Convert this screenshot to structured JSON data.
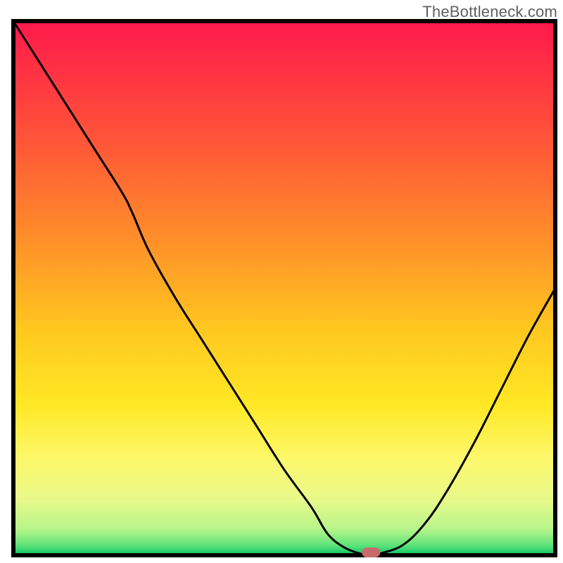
{
  "attribution": "TheBottleneck.com",
  "chart_data": {
    "type": "line",
    "title": "",
    "xlabel": "",
    "ylabel": "",
    "xlim": [
      0,
      100
    ],
    "ylim": [
      0,
      100
    ],
    "x": [
      0,
      5,
      10,
      15,
      20,
      22,
      25,
      30,
      35,
      40,
      45,
      50,
      55,
      58,
      61,
      64,
      66,
      68,
      72,
      76,
      80,
      85,
      90,
      95,
      100
    ],
    "values": [
      100,
      92,
      84,
      76,
      68,
      64,
      57,
      48,
      40,
      32,
      24,
      16,
      9,
      4,
      1.5,
      0.3,
      0,
      0.4,
      2,
      6,
      12,
      21,
      31,
      41,
      50
    ],
    "minimum_marker": {
      "x": 66,
      "y": 0
    },
    "gradient_stops": [
      {
        "offset": 0.0,
        "color": "#ff1a4b"
      },
      {
        "offset": 0.2,
        "color": "#ff4f3a"
      },
      {
        "offset": 0.4,
        "color": "#ff8c2a"
      },
      {
        "offset": 0.58,
        "color": "#ffc81f"
      },
      {
        "offset": 0.72,
        "color": "#ffe825"
      },
      {
        "offset": 0.82,
        "color": "#fdf86a"
      },
      {
        "offset": 0.9,
        "color": "#e8f98a"
      },
      {
        "offset": 0.955,
        "color": "#b6f58a"
      },
      {
        "offset": 0.985,
        "color": "#5fe37a"
      },
      {
        "offset": 1.0,
        "color": "#18c96b"
      }
    ]
  }
}
